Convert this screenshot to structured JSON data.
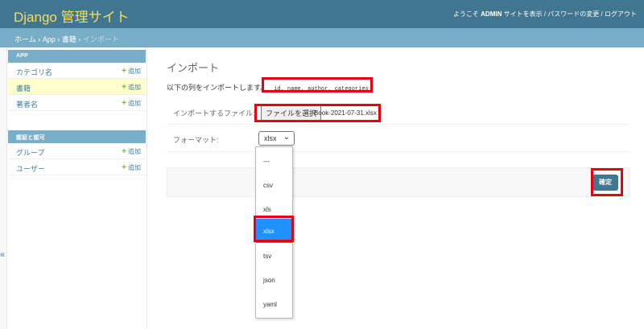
{
  "header": {
    "branding": "Django 管理サイト",
    "welcome": "ようこそ",
    "user": "ADMIN",
    "view_site": "サイトを表示",
    "change_password": "パスワードの変更",
    "logout": "ログアウト",
    "sep": "/"
  },
  "breadcrumbs": {
    "home": "ホーム",
    "app": "App",
    "model": "書籍",
    "current": "インポート",
    "sep": "›"
  },
  "sidebar": {
    "toggle": "«",
    "modules": [
      {
        "caption": "APP",
        "rows": [
          {
            "name": "カテゴリ名",
            "add": "追加"
          },
          {
            "name": "書籍",
            "add": "追加"
          },
          {
            "name": "著者名",
            "add": "追加"
          }
        ]
      },
      {
        "caption": "認証と認可",
        "rows": [
          {
            "name": "グループ",
            "add": "追加"
          },
          {
            "name": "ユーザー",
            "add": "追加"
          }
        ]
      }
    ],
    "plus_icon": "+"
  },
  "content": {
    "title": "インポート",
    "info_text": "以下の列をインポートします。",
    "fields": "id, name, author, categories",
    "file_label": "インポートするファイル:",
    "file_button": "ファイルを選択",
    "file_name": "Book-2021-07-31.xlsx",
    "format_label": "フォーマット:",
    "format_value": "xlsx",
    "format_chevron": "⌄",
    "submit": "確定"
  },
  "format_options": [
    "---",
    "csv",
    "xls",
    "xlsx",
    "tsv",
    "json",
    "yaml"
  ],
  "format_selected": "xlsx",
  "colors": {
    "header_bg": "#417690",
    "branding": "#f5dd5d",
    "breadcrumb_bg": "#79aec8",
    "link": "#447e9b",
    "highlight_box": "#e60012",
    "selected_option": "#1e90ff"
  }
}
